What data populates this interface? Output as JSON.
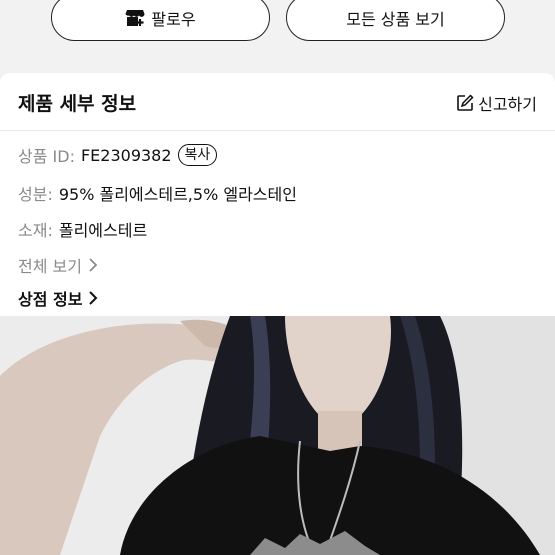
{
  "top_buttons": {
    "follow_label": "팔로우",
    "all_products_label": "모든 상품 보기"
  },
  "details": {
    "title": "제품 세부 정보",
    "report_label": "신고하기",
    "product_id_label": "상품 ID:",
    "product_id_value": "FE2309382",
    "copy_label": "복사",
    "composition_label": "성분:",
    "composition_value": "95% 폴리에스테르,5% 엘라스테인",
    "material_label": "소재:",
    "material_value": "폴리에스테르",
    "see_all_label": "전체 보기",
    "shop_info_label": "상점 정보"
  },
  "colors": {
    "background": "#f2f2f2",
    "card": "#ffffff",
    "label_gray": "#8a8a8a",
    "text": "#111111"
  }
}
